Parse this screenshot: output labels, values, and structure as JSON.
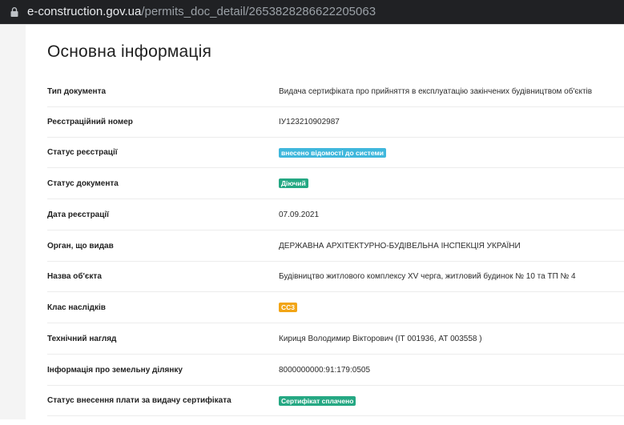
{
  "browser": {
    "url_host": "e-construction.gov.ua",
    "url_path": "/permits_doc_detail/2653828286622205063"
  },
  "section": {
    "title": "Основна інформація"
  },
  "rows": [
    {
      "label": "Тип документа",
      "value": "Видача сертифіката про прийняття в експлуатацію закінчених будівництвом об'єктів"
    },
    {
      "label": "Реєстраційний номер",
      "value": "ІУ123210902987"
    },
    {
      "label": "Статус реєстрації",
      "badge": "внесено відомості до системи",
      "badge_color": "#3fb7dc"
    },
    {
      "label": "Статус документа",
      "badge": "Діючий",
      "badge_color": "#25a883"
    },
    {
      "label": "Дата реєстрації",
      "value": "07.09.2021"
    },
    {
      "label": "Орган, що видав",
      "value": "ДЕРЖАВНА АРХІТЕКТУРНО-БУДІВЕЛЬНА ІНСПЕКЦІЯ УКРАЇНИ"
    },
    {
      "label": "Назва об'єкта",
      "value": "Будівництво житлового комплексу XV черга, житловий будинок № 10 та ТП № 4"
    },
    {
      "label": "Клас наслідків",
      "badge": "СС3",
      "badge_color": "#f2a516"
    },
    {
      "label": "Технічний нагляд",
      "value": "Кириця Володимир Вікторович (ІТ 001936, АТ 003558 )"
    },
    {
      "label": "Інформація про земельну ділянку",
      "value": "8000000000:91:179:0505"
    },
    {
      "label": "Статус внесення плати за видачу сертифіката",
      "badge": "Сертифікат сплачено",
      "badge_color": "#25a883"
    }
  ]
}
